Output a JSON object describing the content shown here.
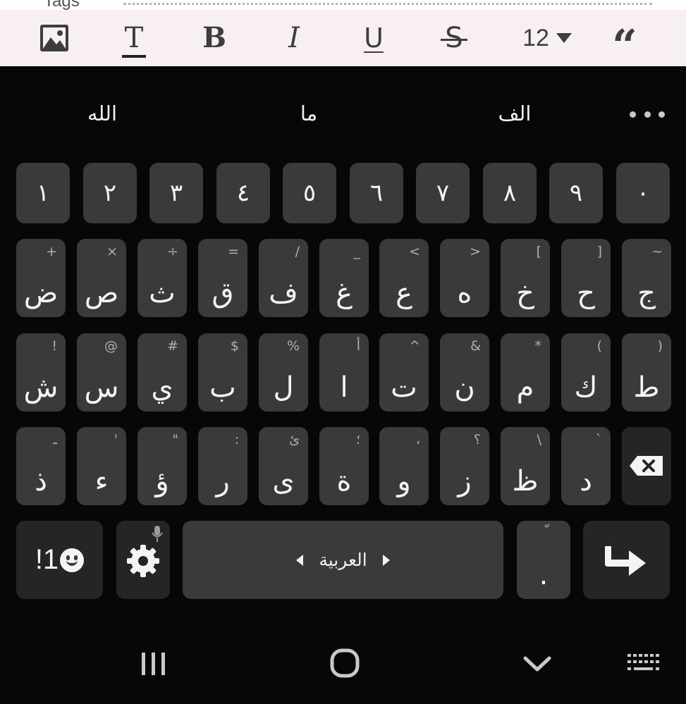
{
  "editor": {
    "field_label": "Tags"
  },
  "toolbar": {
    "text_style_glyph": "T",
    "bold_glyph": "B",
    "italic_glyph": "I",
    "underline_glyph": "U",
    "strike_glyph": "S",
    "font_size": "12",
    "quote_glyph": "“"
  },
  "suggestions": [
    "الله",
    "ما",
    "الف"
  ],
  "keyboard": {
    "number_row": [
      "١",
      "٢",
      "٣",
      "٤",
      "٥",
      "٦",
      "٧",
      "٨",
      "٩",
      "٠"
    ],
    "row1": [
      {
        "main": "ض",
        "hint": "+"
      },
      {
        "main": "ص",
        "hint": "×"
      },
      {
        "main": "ث",
        "hint": "÷"
      },
      {
        "main": "ق",
        "hint": "="
      },
      {
        "main": "ف",
        "hint": "/"
      },
      {
        "main": "غ",
        "hint": "_"
      },
      {
        "main": "ع",
        "hint": "<"
      },
      {
        "main": "ه",
        "hint": ">"
      },
      {
        "main": "خ",
        "hint": "["
      },
      {
        "main": "ح",
        "hint": "]"
      },
      {
        "main": "ج",
        "hint": "~"
      }
    ],
    "row2": [
      {
        "main": "ش",
        "hint": "!"
      },
      {
        "main": "س",
        "hint": "@"
      },
      {
        "main": "ي",
        "hint": "#"
      },
      {
        "main": "ب",
        "hint": "$"
      },
      {
        "main": "ل",
        "hint": "%"
      },
      {
        "main": "ا",
        "hint": "أ"
      },
      {
        "main": "ت",
        "hint": "^"
      },
      {
        "main": "ن",
        "hint": "&"
      },
      {
        "main": "م",
        "hint": "*"
      },
      {
        "main": "ك",
        "hint": "("
      },
      {
        "main": "ط",
        "hint": ")"
      }
    ],
    "row3": [
      {
        "main": "ذ",
        "hint": "ـ"
      },
      {
        "main": "ء",
        "hint": "'"
      },
      {
        "main": "ؤ",
        "hint": "\""
      },
      {
        "main": "ر",
        "hint": ":"
      },
      {
        "main": "ى",
        "hint": "ئ"
      },
      {
        "main": "ة",
        "hint": "؛"
      },
      {
        "main": "و",
        "hint": "،"
      },
      {
        "main": "ز",
        "hint": "؟"
      },
      {
        "main": "ظ",
        "hint": "\\"
      },
      {
        "main": "د",
        "hint": "`"
      }
    ],
    "symbols_label": "!1",
    "space_label": "العربية",
    "period": {
      "main": ".",
      "hint": "ّ"
    }
  },
  "icons": {
    "image": "image-icon",
    "text_style": "text-style-icon",
    "bold": "bold-icon",
    "italic": "italic-icon",
    "underline": "underline-icon",
    "strike": "strikethrough-icon",
    "size_caret": "caret-down-icon",
    "quote": "quote-icon",
    "more": "more-icon",
    "emoji": "smiley-icon",
    "settings": "gear-icon",
    "mic": "mic-icon",
    "backspace": "backspace-icon",
    "enter": "enter-icon",
    "nav_recents": "recents-icon",
    "nav_home": "home-icon",
    "nav_back": "chevron-down-icon",
    "nav_keyboard": "keyboard-icon"
  },
  "colors": {
    "keyboard_bg": "#070707",
    "key": "#3a3a3a",
    "key_dark": "#252525",
    "toolbar_bg": "#f8eff3",
    "text": "#f4f4f4",
    "hint": "#b0b0b0"
  }
}
